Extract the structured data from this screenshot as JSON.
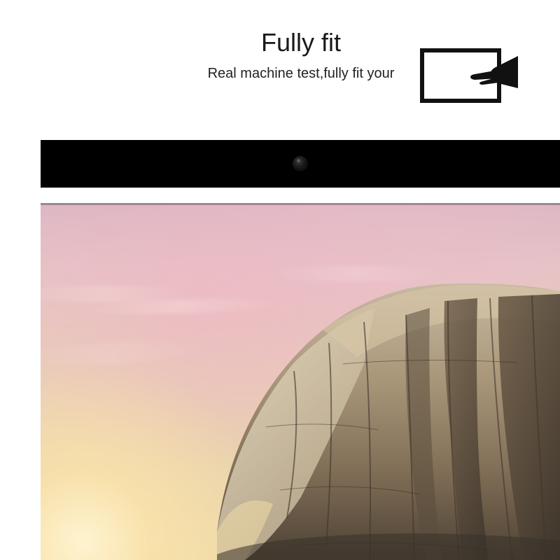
{
  "header": {
    "title": "Fully fit",
    "subtitle": "Real machine test,fully fit your"
  },
  "icon": {
    "name": "tablet-touch-icon"
  }
}
